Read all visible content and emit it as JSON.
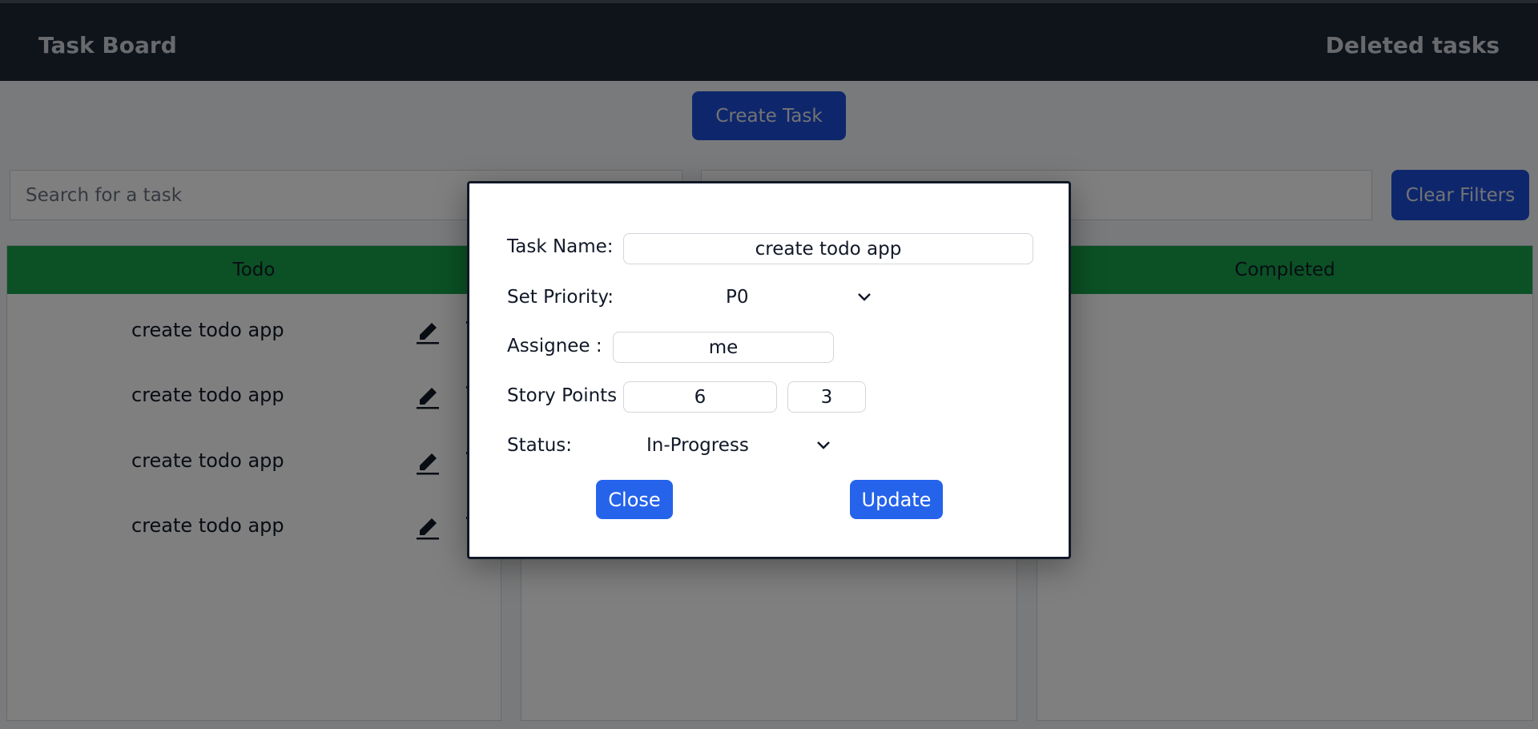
{
  "header": {
    "brand": "Task Board",
    "deleted_link": "Deleted tasks"
  },
  "toolbar": {
    "create_label": "Create Task",
    "search_placeholder": "Search for a task",
    "filter_placeholder": "",
    "clear_label": "Clear Filters"
  },
  "columns": [
    {
      "title": "Todo",
      "tasks": [
        "create todo app",
        "create todo app",
        "create todo app",
        "create todo app"
      ]
    },
    {
      "title": "",
      "tasks": []
    },
    {
      "title": "Completed",
      "tasks": []
    }
  ],
  "icons": {
    "edit": "pencil-edit-icon",
    "delete": "trash-icon",
    "dropdown": "chevron-down-icon"
  },
  "modal": {
    "task_name_label": "Task Name:",
    "task_name_value": "create todo app",
    "priority_label": "Set Priority:",
    "priority_value": "P0",
    "assignee_label": "Assignee :",
    "assignee_value": "me",
    "story_points_label": "Story Points :",
    "story_points_value_1": "6",
    "story_points_value_2": "3",
    "status_label": "Status:",
    "status_value": "In-Progress",
    "close_label": "Close",
    "update_label": "Update"
  },
  "colors": {
    "navbar": "#1f2937",
    "column_header": "#16a34a",
    "primary_button": "#2563eb"
  }
}
